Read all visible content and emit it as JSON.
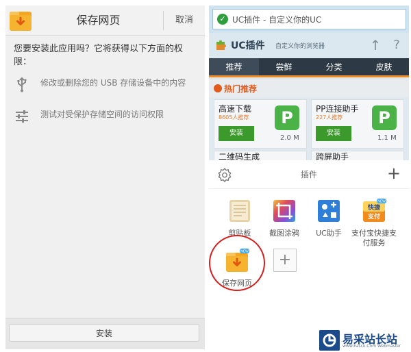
{
  "left": {
    "title": "保存网页",
    "cancel": "取消",
    "question": "您要安装此应用吗？它将获得以下方面的权限：",
    "permissions": [
      {
        "icon": "usb-icon",
        "text": "修改或删除您的 USB 存储设备中的内容"
      },
      {
        "icon": "sliders-icon",
        "text": "测试对受保护存储空间的访问权限"
      }
    ],
    "install": "安装"
  },
  "right": {
    "address": "UC插件 - 自定义你的UC",
    "header": {
      "name": "UC插件",
      "slogan": "自定义你的浏览器",
      "up": "↑",
      "help": "?"
    },
    "tabs": [
      "推荐",
      "尝鲜",
      "分类",
      "皮肤"
    ],
    "hot_label": "热门推荐",
    "cards": [
      {
        "name": "高速下载",
        "rec": "8605人推荐",
        "btn": "安装",
        "size": "2.0 M"
      },
      {
        "name": "PP连接助手",
        "rec": "227人推荐",
        "btn": "安装",
        "size": "1.1 M"
      }
    ],
    "row2": [
      "二维码生成",
      "跨屏助手"
    ],
    "sheet": {
      "title": "插件",
      "plugins": [
        {
          "label": "剪贴板",
          "icon": "clipboard-icon"
        },
        {
          "label": "截图涂鸦",
          "icon": "screenshot-icon"
        },
        {
          "label": "UC助手",
          "icon": "uc-helper-icon"
        },
        {
          "label": "支付宝快捷支付服务",
          "icon": "alipay-icon",
          "badge": "NEW",
          "icon_text": "快捷支付"
        },
        {
          "label": "保存网页",
          "icon": "save-page-icon",
          "badge": "NEW"
        }
      ]
    }
  },
  "watermark": {
    "text": "易采站长站",
    "sub": "www.Easck.Com Webmaster"
  },
  "colors": {
    "tab_bg": "#2d3944",
    "accent": "#f08a24",
    "install_green": "#3c9a2c",
    "highlight_circle": "#d31f1f"
  }
}
